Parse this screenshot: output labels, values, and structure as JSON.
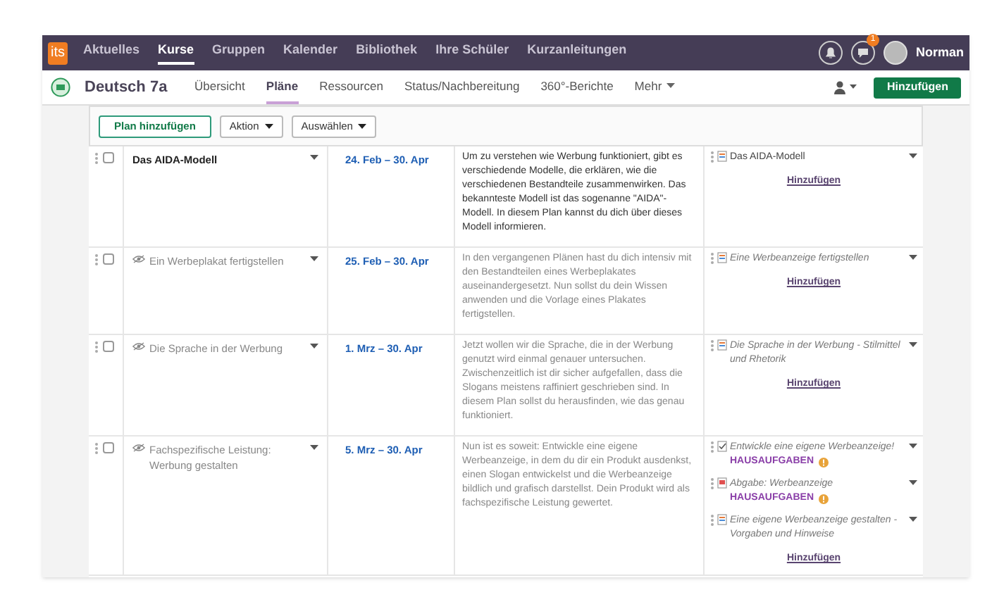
{
  "topnav": {
    "logo": "its",
    "items": [
      {
        "label": "Aktuelles",
        "selected": false
      },
      {
        "label": "Kurse",
        "selected": true
      },
      {
        "label": "Gruppen",
        "selected": false
      },
      {
        "label": "Kalender",
        "selected": false
      },
      {
        "label": "Bibliothek",
        "selected": false
      },
      {
        "label": "Ihre Schüler",
        "selected": false
      },
      {
        "label": "Kurzanleitungen",
        "selected": false
      }
    ],
    "message_badge": "1",
    "user": "Norman"
  },
  "course": {
    "title": "Deutsch 7a",
    "tabs": [
      {
        "label": "Übersicht",
        "selected": false
      },
      {
        "label": "Pläne",
        "selected": true
      },
      {
        "label": "Ressourcen",
        "selected": false
      },
      {
        "label": "Status/Nachbereitung",
        "selected": false
      },
      {
        "label": "360°-Berichte",
        "selected": false
      },
      {
        "label": "Mehr",
        "selected": false
      }
    ],
    "add_button": "Hinzufügen"
  },
  "toolbar": {
    "add_plan": "Plan hinzufügen",
    "action": "Aktion",
    "select": "Auswählen"
  },
  "plans": [
    {
      "title": "Das AIDA-Modell",
      "published": true,
      "checked": false,
      "dates": "24. Feb – 30. Apr",
      "description": "Um zu verstehen wie Werbung funktioniert, gibt es verschiedende Modelle, die erklären, wie die verschiedenen Bestandteile zusammenwirken. Das bekannteste Modell ist das sogenanne \"AIDA\"-Modell. In diesem Plan kannst du dich über dieses Modell informieren.",
      "items": [
        {
          "kind": "material",
          "text": "Das AIDA-Modell",
          "published": true
        }
      ],
      "add_link": "Hinzufügen"
    },
    {
      "title": "Ein Werbeplakat fertigstellen",
      "published": false,
      "checked": false,
      "dates": "25. Feb – 30. Apr",
      "description": "In den vergangenen Plänen hast du dich intensiv mit den Bestandteilen eines Werbeplakates auseinandergesetzt. Nun sollst du dein Wissen anwenden und die Vorlage eines Plakates fertigstellen.",
      "items": [
        {
          "kind": "material",
          "text": "Eine Werbeanzeige fertigstellen",
          "published": false
        }
      ],
      "add_link": "Hinzufügen"
    },
    {
      "title": "Die Sprache in der Werbung",
      "published": false,
      "checked": false,
      "dates": "1. Mrz – 30. Apr",
      "description": "Jetzt wollen wir die Sprache, die in der Werbung genutzt wird einmal genauer untersuchen. Zwischenzeitlich ist dir sicher aufgefallen, dass die Slogans meistens raffiniert geschrieben sind. In diesem Plan sollst du herausfinden, wie das genau funktioniert.",
      "items": [
        {
          "kind": "material",
          "text": "Die Sprache in der Werbung - Stilmittel und Rhetorik",
          "published": false
        }
      ],
      "add_link": "Hinzufügen"
    },
    {
      "title": "Fachspezifische Leistung: Werbung gestalten",
      "published": false,
      "checked": false,
      "dates": "5. Mrz – 30. Apr",
      "description": "Nun ist es soweit: Entwickle eine eigene Werbeanzeige, in dem du dir ein Produkt ausdenkst, einen Slogan entwickelst und die Werbeanzeige bildlich und grafisch darstellst. Dein Produkt wird als fachspezifische Leistung gewertet.",
      "items": [
        {
          "kind": "task",
          "text": "Entwickle eine eigene Werbeanzeige!",
          "published": false,
          "badge": "HAUSAUFGABEN"
        },
        {
          "kind": "submission",
          "text": "Abgabe: Werbeanzeige",
          "published": false,
          "badge": "HAUSAUFGABEN"
        },
        {
          "kind": "material",
          "text": "Eine eigene Werbeanzeige gestalten - Vorgaben und Hinweise",
          "published": false
        }
      ],
      "add_link": "Hinzufügen"
    }
  ]
}
